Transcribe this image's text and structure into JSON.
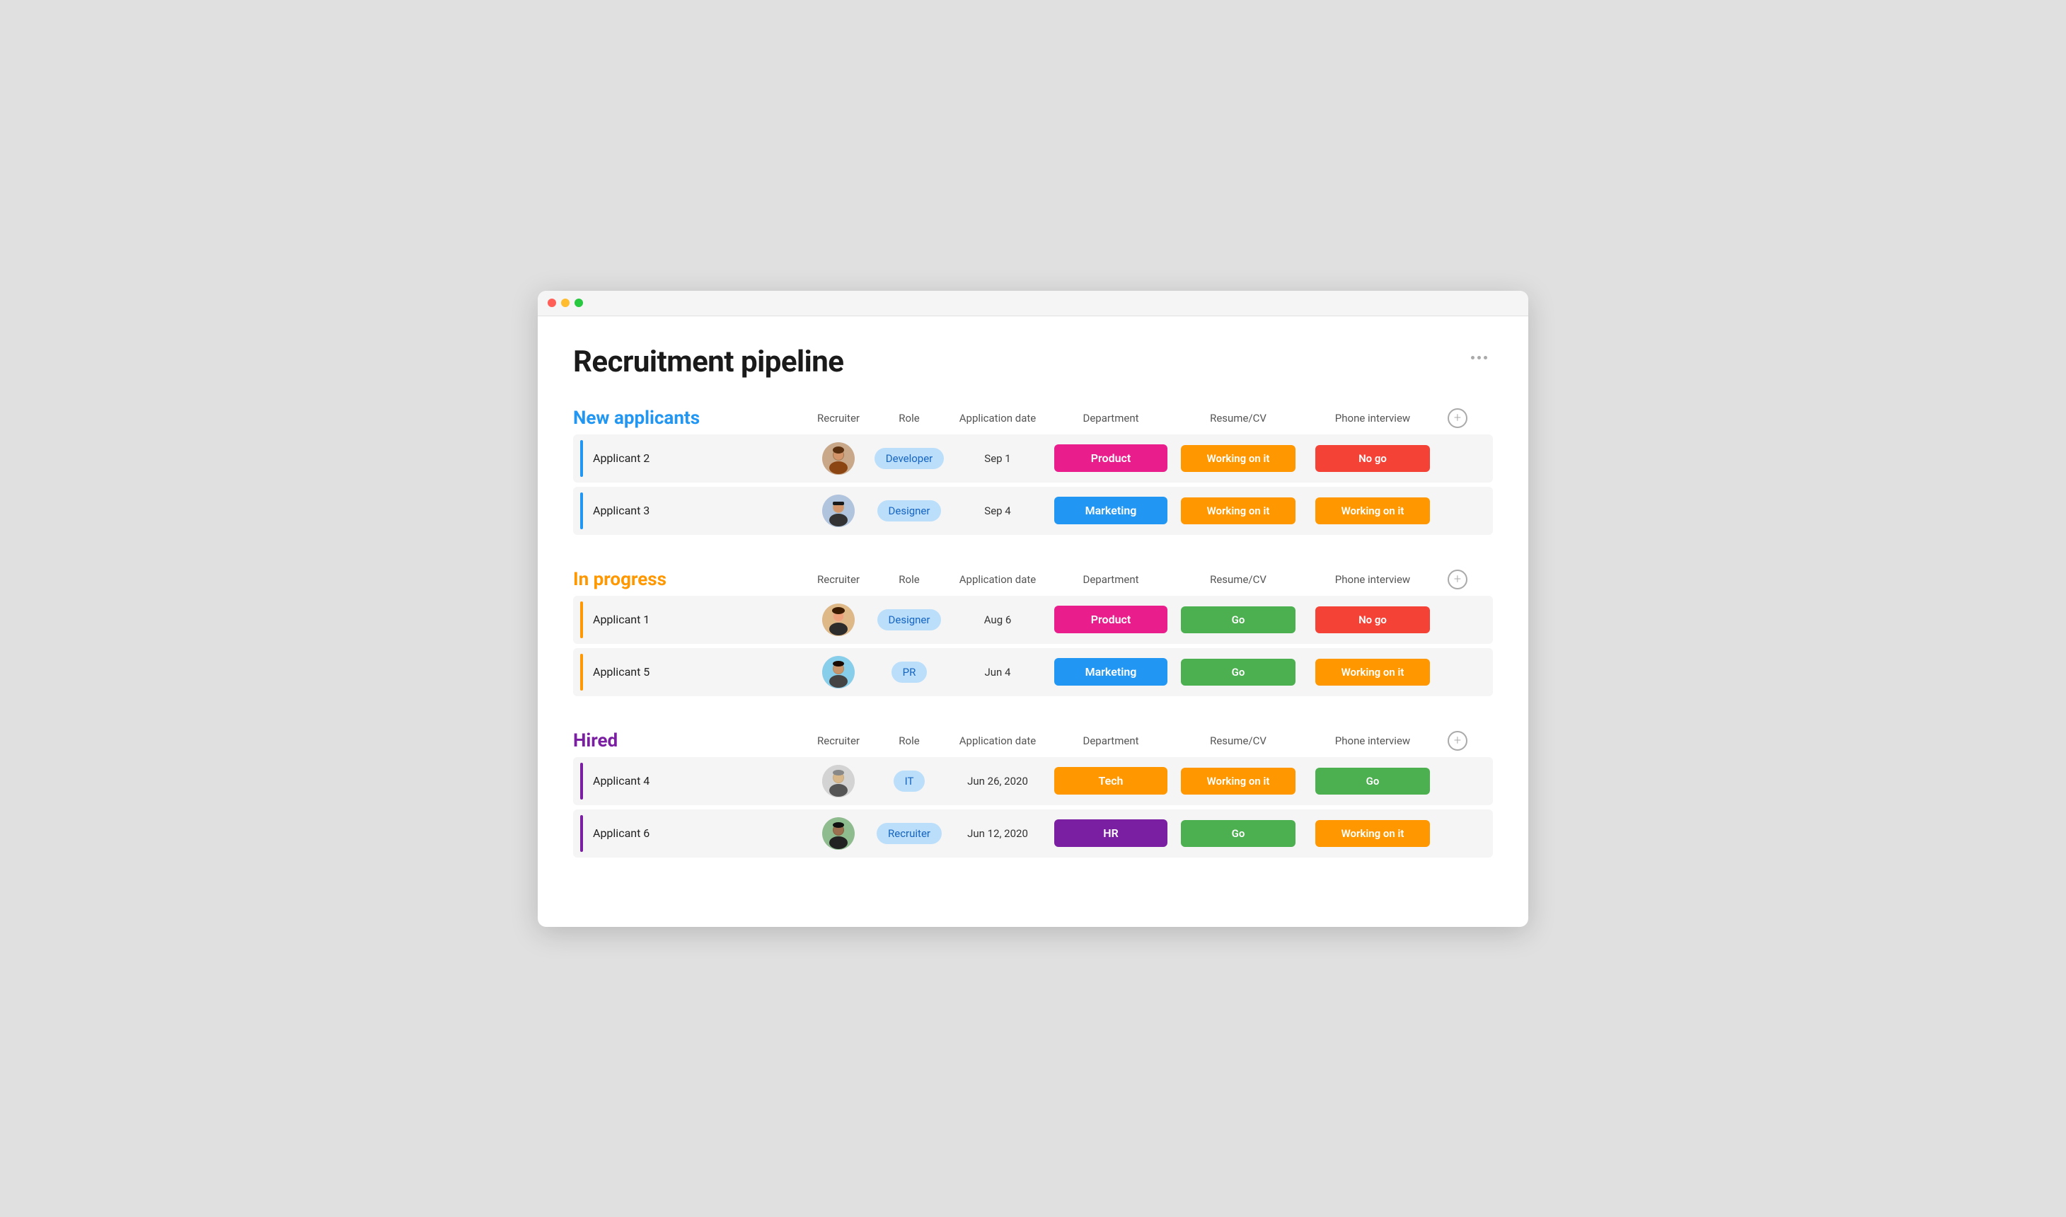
{
  "window": {
    "title": "Recruitment pipeline"
  },
  "page": {
    "title": "Recruitment pipeline",
    "more_icon": "more-horizontal-icon"
  },
  "columns": {
    "recruiter": "Recruiter",
    "role": "Role",
    "application_date": "Application date",
    "department": "Department",
    "resume_cv": "Resume/CV",
    "phone_interview": "Phone interview"
  },
  "sections": [
    {
      "id": "new-applicants",
      "title": "New applicants",
      "color_class": "blue",
      "bar_class": "bar-blue",
      "rows": [
        {
          "name": "Applicant 2",
          "recruiter_avatar": "female-1",
          "role": "Developer",
          "application_date": "Sep 1",
          "department": "Product",
          "department_class": "dept-product",
          "resume_cv": "Working on it",
          "resume_cv_class": "status-working",
          "phone_interview": "No go",
          "phone_interview_class": "status-nogo"
        },
        {
          "name": "Applicant 3",
          "recruiter_avatar": "male-1",
          "role": "Designer",
          "application_date": "Sep 4",
          "department": "Marketing",
          "department_class": "dept-marketing",
          "resume_cv": "Working on it",
          "resume_cv_class": "status-working",
          "phone_interview": "Working on it",
          "phone_interview_class": "status-working"
        }
      ]
    },
    {
      "id": "in-progress",
      "title": "In progress",
      "color_class": "orange",
      "bar_class": "bar-orange",
      "rows": [
        {
          "name": "Applicant 1",
          "recruiter_avatar": "female-2",
          "role": "Designer",
          "application_date": "Aug 6",
          "department": "Product",
          "department_class": "dept-product",
          "resume_cv": "Go",
          "resume_cv_class": "status-go",
          "phone_interview": "No go",
          "phone_interview_class": "status-nogo"
        },
        {
          "name": "Applicant 5",
          "recruiter_avatar": "male-2",
          "role": "PR",
          "application_date": "Jun 4",
          "department": "Marketing",
          "department_class": "dept-marketing",
          "resume_cv": "Go",
          "resume_cv_class": "status-go",
          "phone_interview": "Working on it",
          "phone_interview_class": "status-working"
        }
      ]
    },
    {
      "id": "hired",
      "title": "Hired",
      "color_class": "purple",
      "bar_class": "bar-purple",
      "rows": [
        {
          "name": "Applicant 4",
          "recruiter_avatar": "male-3",
          "role": "IT",
          "application_date": "Jun 26, 2020",
          "department": "Tech",
          "department_class": "dept-tech",
          "resume_cv": "Working on it",
          "resume_cv_class": "status-working",
          "phone_interview": "Go",
          "phone_interview_class": "status-go"
        },
        {
          "name": "Applicant 6",
          "recruiter_avatar": "male-4",
          "role": "Recruiter",
          "application_date": "Jun 12, 2020",
          "department": "HR",
          "department_class": "dept-hr",
          "resume_cv": "Go",
          "resume_cv_class": "status-go",
          "phone_interview": "Working on it",
          "phone_interview_class": "status-working"
        }
      ]
    }
  ]
}
